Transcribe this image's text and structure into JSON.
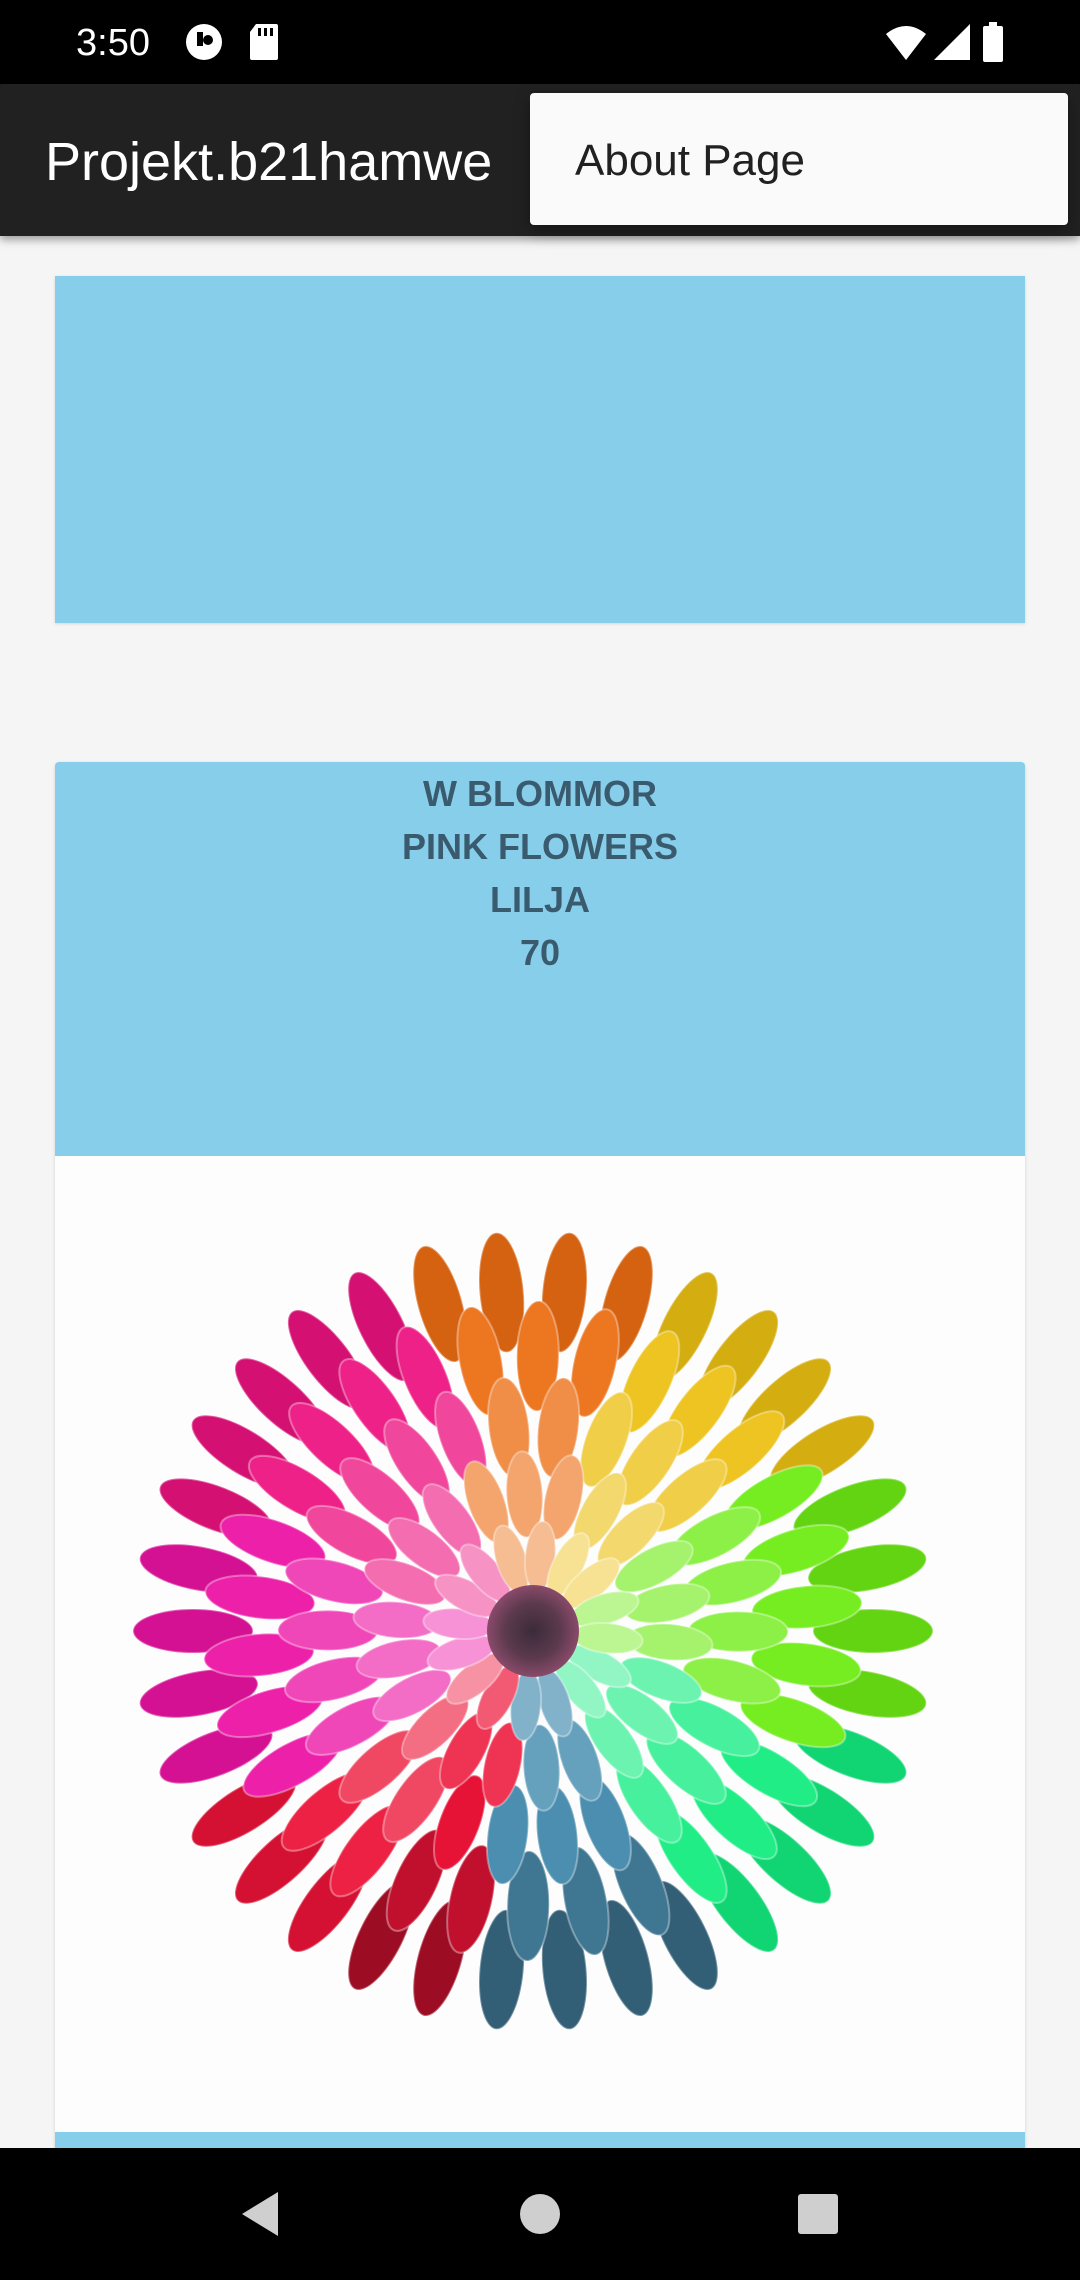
{
  "status_bar": {
    "time": "3:50",
    "icons": [
      "app-notification-icon",
      "sd-card-icon",
      "wifi-icon",
      "cellular-signal-icon",
      "battery-icon"
    ]
  },
  "app_bar": {
    "title": "Projekt.b21hamwe"
  },
  "popup_menu": {
    "items": [
      {
        "label": "About Page"
      }
    ]
  },
  "cards": [
    {
      "lines": []
    },
    {
      "lines": [
        "W BLOMMOR",
        "PINK FLOWERS",
        "LILJA",
        "70"
      ],
      "image": "rainbow-chrysanthemum-flower"
    }
  ],
  "nav_bar": {
    "buttons": [
      "back-icon",
      "home-icon",
      "recents-icon"
    ]
  },
  "colors": {
    "app_bar": "#212121",
    "card_accent": "#87ceeb",
    "card_text": "#3a5a6e",
    "content_bg": "#f5f5f5"
  }
}
